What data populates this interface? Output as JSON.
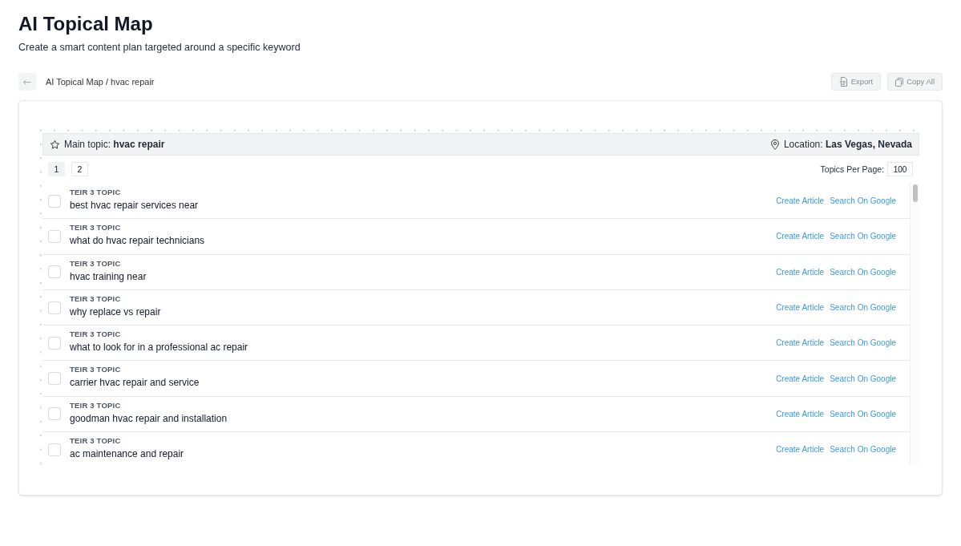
{
  "page": {
    "title": "AI Topical Map",
    "subtitle": "Create a smart content plan targeted around a specific keyword"
  },
  "toolbar": {
    "breadcrumb": "AI Topical Map / hvac repair",
    "buttons": [
      {
        "label": "Export",
        "kind": "export"
      },
      {
        "label": "Copy All",
        "kind": "copy"
      }
    ]
  },
  "main_topic": "Main topic: **hvac repair**",
  "location": "Location: **Las Vegas, Nevada**",
  "pagination": [
    {
      "label": "1",
      "selected": true
    },
    {
      "label": "2",
      "selected": false
    }
  ],
  "per_page": {
    "label": "Topics Per Page:",
    "value": "100"
  },
  "topics": [
    {
      "tier": "TEIR 3 TOPIC",
      "title": "best hvac repair services near",
      "checked": false,
      "actions": [
        "Create Article",
        "Search On Google"
      ]
    },
    {
      "tier": "TEIR 3 TOPIC",
      "title": "what do hvac repair technicians",
      "checked": false,
      "actions": [
        "Create Article",
        "Search On Google"
      ]
    },
    {
      "tier": "TEIR 3 TOPIC",
      "title": "hvac training near",
      "checked": false,
      "actions": [
        "Create Article",
        "Search On Google"
      ]
    },
    {
      "tier": "TEIR 3 TOPIC",
      "title": "why replace vs repair",
      "checked": false,
      "actions": [
        "Create Article",
        "Search On Google"
      ]
    },
    {
      "tier": "TEIR 3 TOPIC",
      "title": "what to look for in a professional ac repair",
      "checked": false,
      "actions": [
        "Create Article",
        "Search On Google"
      ]
    },
    {
      "tier": "TEIR 3 TOPIC",
      "title": "carrier hvac repair and service",
      "checked": false,
      "actions": [
        "Create Article",
        "Search On Google"
      ]
    },
    {
      "tier": "TEIR 3 TOPIC",
      "title": "goodman hvac repair and installation",
      "checked": false,
      "actions": [
        "Create Article",
        "Search On Google"
      ]
    },
    {
      "tier": "TEIR 3 TOPIC",
      "title": "ac maintenance and repair",
      "checked": false,
      "actions": [
        "Create Article",
        "Search On Google"
      ]
    }
  ]
}
